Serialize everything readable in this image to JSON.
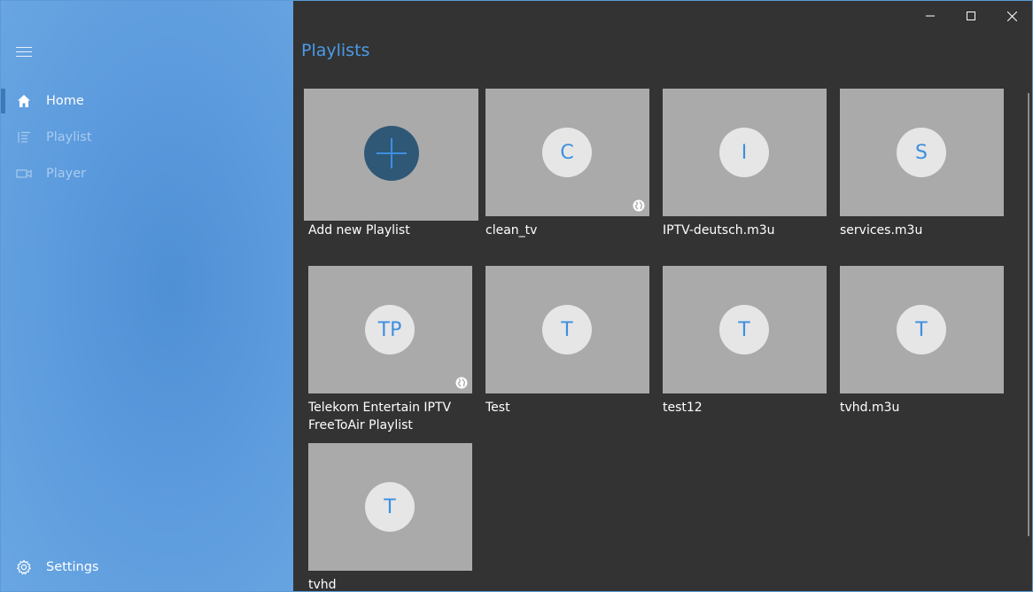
{
  "window": {
    "controls": [
      "minimize",
      "maximize",
      "close"
    ]
  },
  "sidebar": {
    "menu_icon": "hamburger-icon",
    "items": [
      {
        "label": "Home",
        "icon": "home-icon",
        "active": true
      },
      {
        "label": "Playlist",
        "icon": "list-icon",
        "active": false
      },
      {
        "label": "Player",
        "icon": "video-camera-icon",
        "active": false
      }
    ],
    "settings": {
      "label": "Settings",
      "icon": "gear-icon"
    }
  },
  "main": {
    "title": "Playlists",
    "add_tile": {
      "label": "Add new Playlist",
      "icon": "plus-icon"
    },
    "playlists": [
      {
        "initials": "C",
        "name": "clean_tv",
        "online": true
      },
      {
        "initials": "I",
        "name": "IPTV-deutsch.m3u",
        "online": false
      },
      {
        "initials": "S",
        "name": "services.m3u",
        "online": false
      },
      {
        "initials": "TP",
        "name": "Telekom Entertain IPTV\nFreeToAir Playlist",
        "online": true
      },
      {
        "initials": "T",
        "name": "Test",
        "online": false
      },
      {
        "initials": "T",
        "name": "test12",
        "online": false
      },
      {
        "initials": "T",
        "name": "tvhd.m3u",
        "online": false
      },
      {
        "initials": "T",
        "name": "tvhd",
        "online": false
      }
    ]
  },
  "colors": {
    "accent": "#4a9be8",
    "sidebar": "#5b9add",
    "background": "#333333",
    "tile": "#aaaaaa",
    "add_circle": "#2f5877"
  }
}
